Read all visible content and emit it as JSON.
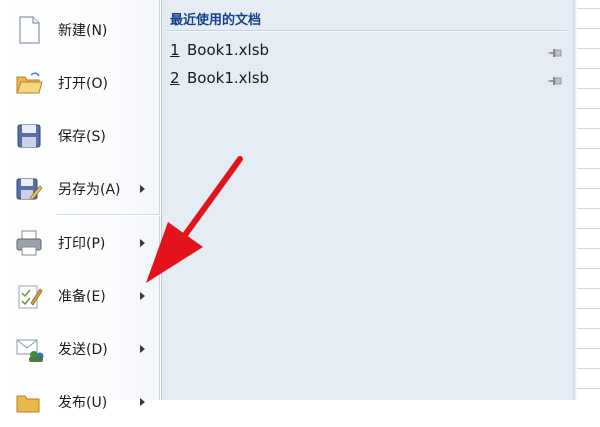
{
  "menu": {
    "items": [
      {
        "label": "新建(N)",
        "has_submenu": false,
        "icon": "new-document-icon"
      },
      {
        "label": "打开(O)",
        "has_submenu": false,
        "icon": "open-folder-icon"
      },
      {
        "label": "保存(S)",
        "has_submenu": false,
        "icon": "save-disk-icon"
      },
      {
        "label": "另存为(A)",
        "has_submenu": true,
        "icon": "save-as-icon"
      },
      {
        "label": "打印(P)",
        "has_submenu": true,
        "icon": "printer-icon"
      },
      {
        "label": "准备(E)",
        "has_submenu": true,
        "icon": "prepare-icon"
      },
      {
        "label": "发送(D)",
        "has_submenu": true,
        "icon": "send-icon"
      },
      {
        "label": "发布(U)",
        "has_submenu": true,
        "icon": "publish-icon"
      }
    ]
  },
  "recent": {
    "title": "最近使用的文档",
    "documents": [
      {
        "number": "1",
        "name": "Book1.xlsb"
      },
      {
        "number": "2",
        "name": "Book1.xlsb"
      }
    ]
  },
  "colors": {
    "title_blue": "#15428b",
    "panel_bg": "#e6ecf4",
    "annotation_red": "#e3131b"
  }
}
